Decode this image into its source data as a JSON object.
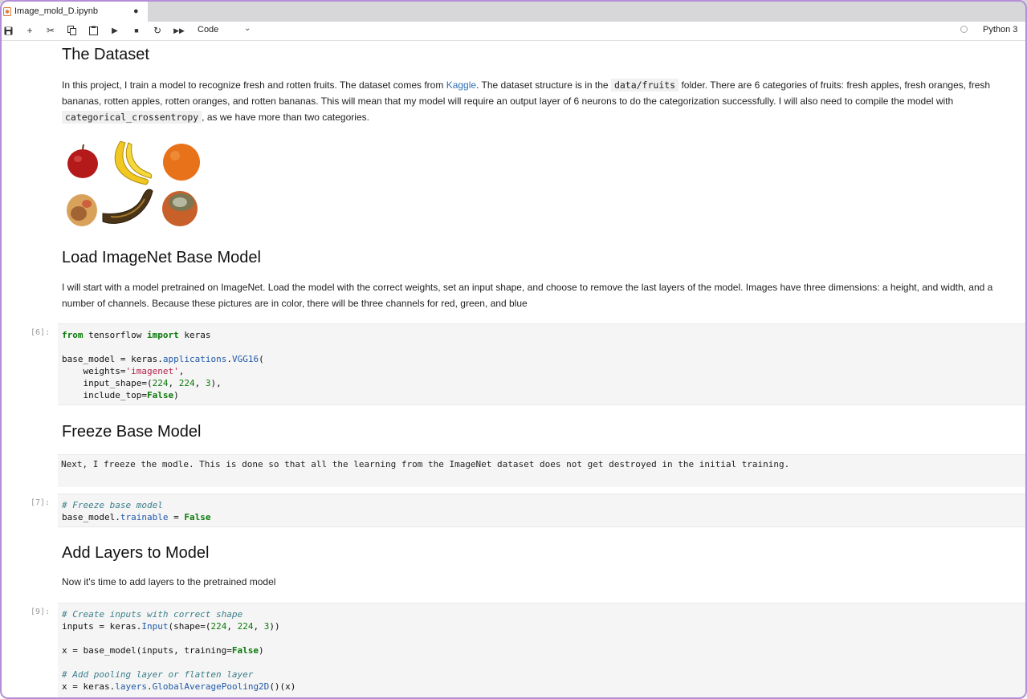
{
  "tab": {
    "title": "Image_mold_D.ipynb",
    "modified_dot": "●"
  },
  "toolbar": {
    "icons": [
      "save-icon",
      "add-cell-icon",
      "cut-icon",
      "copy-icon",
      "paste-icon",
      "run-icon",
      "stop-icon",
      "restart-icon",
      "run-all-icon"
    ],
    "cell_type": "Code",
    "kernel": "Python 3"
  },
  "sections": {
    "dataset_heading": "The Dataset",
    "dataset_p1_a": "In this project, I train a model to recognize fresh and rotten fruits. The dataset comes from ",
    "dataset_link": "Kaggle",
    "dataset_p1_b": ". The dataset structure is in the ",
    "dataset_path": "data/fruits",
    "dataset_p1_c": " folder. There are 6 categories of fruits: fresh apples, fresh oranges, fresh bananas, rotten apples, rotten oranges, and rotten bananas. This will mean that my model will require an output layer of 6 neurons to do the categorization successfully. I will also need to compile the model with ",
    "dataset_loss": "categorical_crossentropy",
    "dataset_p1_d": ", as we have more than two categories.",
    "load_heading": "Load ImageNet Base Model",
    "load_p": "I will start with a model pretrained on ImageNet. Load the model with the correct weights, set an input shape, and choose to remove the last layers of the model. Images have three dimensions: a height, and width, and a number of channels. Because these pictures are in color, there will be three channels for red, green, and blue",
    "freeze_heading": "Freeze Base Model",
    "freeze_raw": "Next, I freeze the modle. This is done so that all the learning from the ImageNet dataset does not get destroyed in the initial training.",
    "add_heading": "Add Layers to Model",
    "add_p": "Now it's time to add layers to the pretrained model"
  },
  "cells": {
    "cell6_prompt": "[6]:",
    "cell7_prompt": "[7]:",
    "cell9_prompt": "[9]:"
  }
}
